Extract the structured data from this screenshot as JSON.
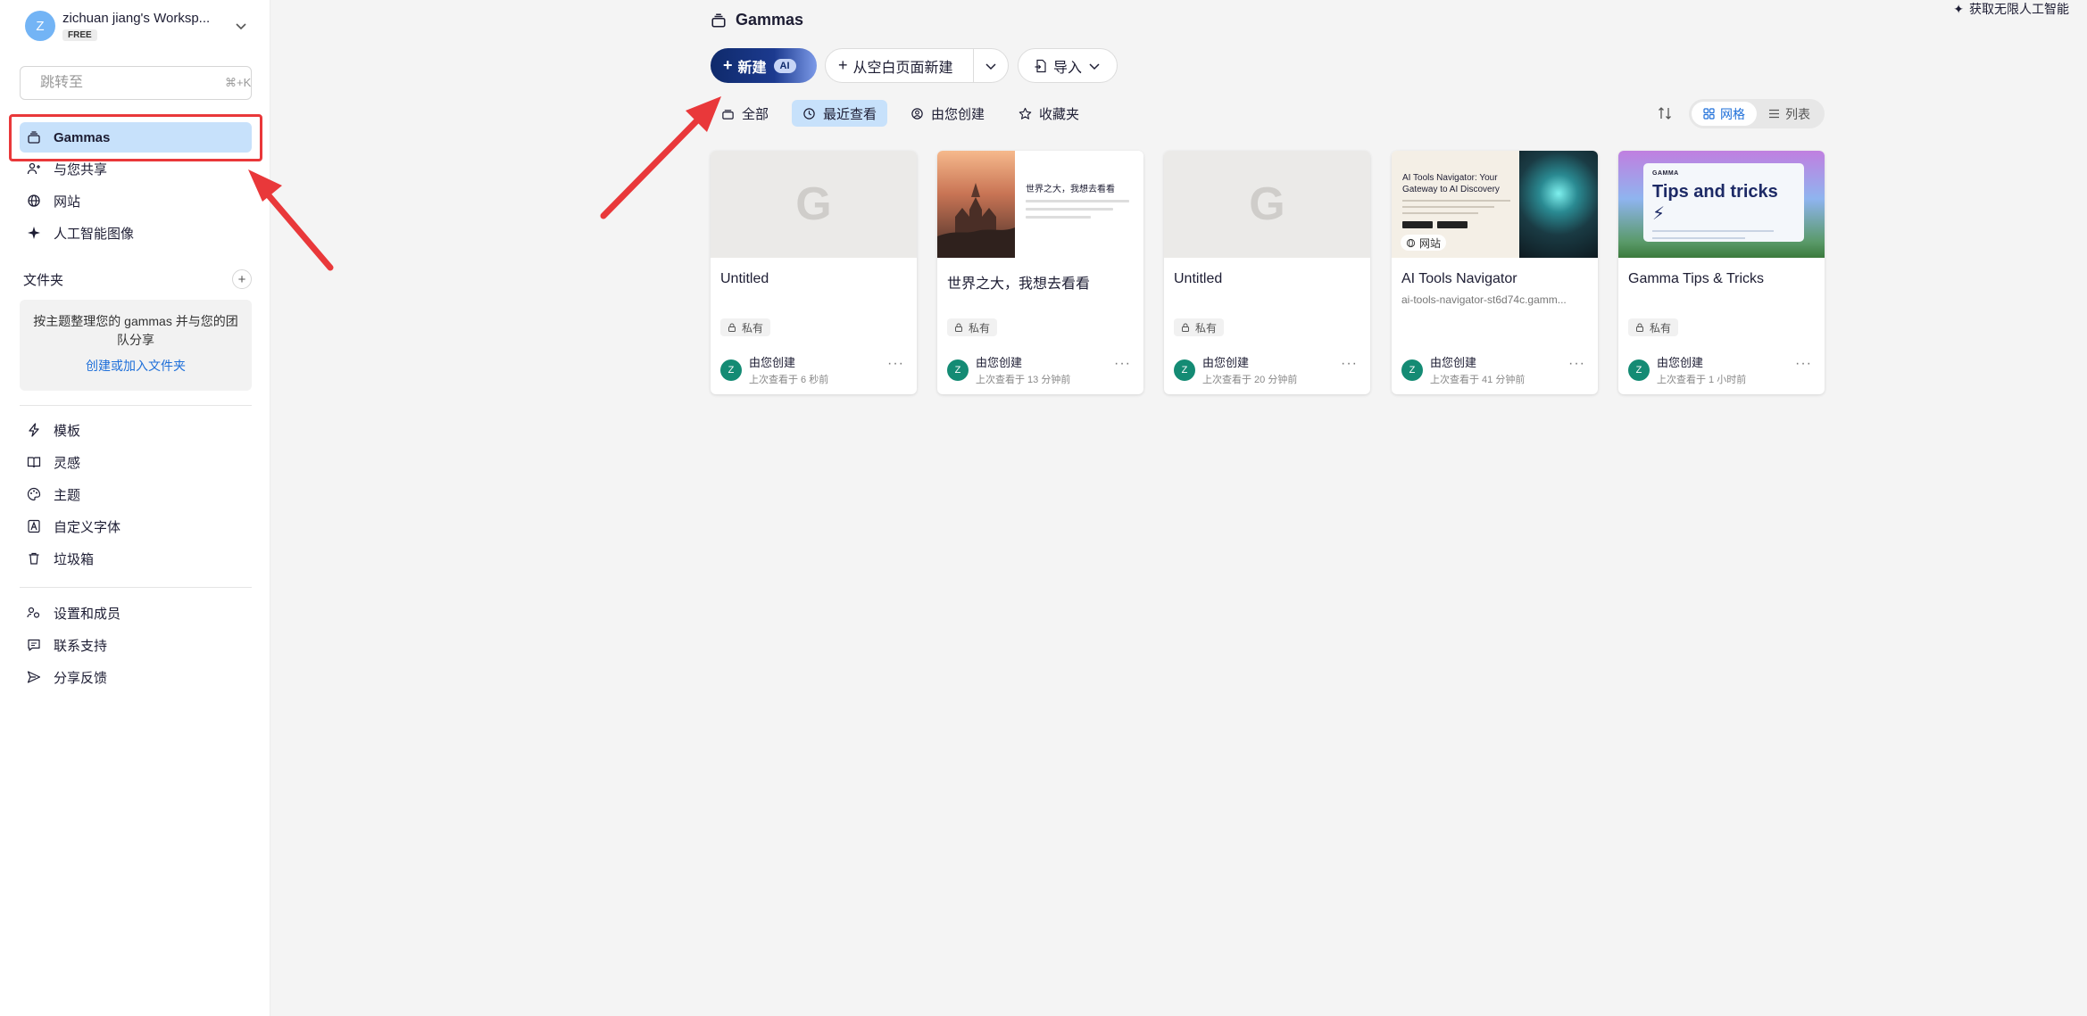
{
  "workspace": {
    "avatar_letter": "Z",
    "name": "zichuan jiang's Worksp...",
    "plan": "FREE"
  },
  "search": {
    "placeholder": "跳转至",
    "shortcut": "⌘+K"
  },
  "nav_primary": [
    {
      "label": "Gammas",
      "icon": "gammas-icon",
      "active": true
    },
    {
      "label": "与您共享",
      "icon": "shared-users-icon"
    },
    {
      "label": "网站",
      "icon": "globe-icon"
    },
    {
      "label": "人工智能图像",
      "icon": "sparkle-icon"
    }
  ],
  "folders": {
    "header": "文件夹",
    "description": "按主题整理您的 gammas 并与您的团队分享",
    "link": "创建或加入文件夹"
  },
  "nav_secondary": [
    {
      "label": "模板",
      "icon": "bolt-icon"
    },
    {
      "label": "灵感",
      "icon": "book-icon"
    },
    {
      "label": "主题",
      "icon": "palette-icon"
    },
    {
      "label": "自定义字体",
      "icon": "font-icon"
    },
    {
      "label": "垃圾箱",
      "icon": "trash-icon"
    }
  ],
  "nav_tertiary": [
    {
      "label": "设置和成员",
      "icon": "settings-members-icon"
    },
    {
      "label": "联系支持",
      "icon": "chat-icon"
    },
    {
      "label": "分享反馈",
      "icon": "send-icon"
    }
  ],
  "header": {
    "title": "Gammas",
    "upgrade": "获取无限人工智能"
  },
  "actions": {
    "new_label": "新建",
    "new_badge": "AI",
    "blank_label": "从空白页面新建",
    "import_label": "导入"
  },
  "filters": [
    {
      "label": "全部",
      "icon": "gammas-icon"
    },
    {
      "label": "最近查看",
      "icon": "clock-icon",
      "active": true
    },
    {
      "label": "由您创建",
      "icon": "user-circle-icon"
    },
    {
      "label": "收藏夹",
      "icon": "star-icon"
    }
  ],
  "view_toggle": {
    "grid": "网格",
    "list": "列表",
    "active": "grid"
  },
  "cards": [
    {
      "title": "Untitled",
      "subtitle": "",
      "thumb": "blank",
      "tag": "私有",
      "owner": "由您创建",
      "time": "上次查看于 6 秒前",
      "avatar": "Z"
    },
    {
      "title": "世界之大，我想去看看",
      "subtitle": "",
      "thumb": "world",
      "thumb_title": "世界之大，我想去看看",
      "tag": "私有",
      "owner": "由您创建",
      "time": "上次查看于 13 分钟前",
      "avatar": "Z"
    },
    {
      "title": "Untitled",
      "subtitle": "",
      "thumb": "blank",
      "tag": "私有",
      "owner": "由您创建",
      "time": "上次查看于 20 分钟前",
      "avatar": "Z"
    },
    {
      "title": "AI Tools Navigator",
      "subtitle": "ai-tools-navigator-st6d74c.gamm...",
      "thumb": "ai",
      "thumb_title": "AI Tools Navigator: Your Gateway to AI Discovery",
      "thumb_badge": "网站",
      "tag": "",
      "owner": "由您创建",
      "time": "上次查看于 41 分钟前",
      "avatar": "Z"
    },
    {
      "title": "Gamma Tips & Tricks",
      "subtitle": "",
      "thumb": "tips",
      "thumb_brand": "GAMMA",
      "thumb_title": "Tips and tricks ⚡",
      "tag": "私有",
      "owner": "由您创建",
      "time": "上次查看于 1 小时前",
      "avatar": "Z"
    }
  ],
  "colors": {
    "accent": "#1e6fd9",
    "active_bg": "#c7e1fb",
    "primary_btn": "#0f2a6b",
    "annotation_red": "#e9383a",
    "avatar_green": "#148b74"
  }
}
